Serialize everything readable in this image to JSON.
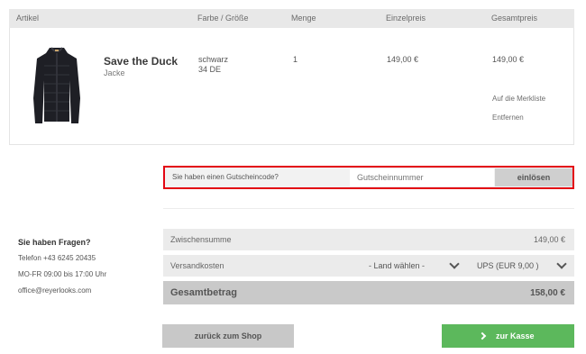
{
  "cart": {
    "headers": {
      "article": "Artikel",
      "color_size": "Farbe / Größe",
      "quantity": "Menge",
      "unit_price": "Einzelpreis",
      "total_price": "Gesamtpreis"
    },
    "item": {
      "image_icon": "jacket-image",
      "name": "Save the Duck",
      "type": "Jacke",
      "color": "schwarz",
      "size": "34 DE",
      "quantity": "1",
      "unit_price": "149,00 €",
      "total_price": "149,00 €",
      "wishlist_link": "Auf die Merkliste",
      "remove_link": "Entfernen"
    }
  },
  "coupon": {
    "label": "Sie haben einen Gutscheincode?",
    "placeholder": "Gutscheinnummer",
    "button": "einlösen",
    "highlight_color": "#e30613"
  },
  "totals": {
    "subtotal_label": "Zwischensumme",
    "subtotal_value": "149,00 €",
    "shipping_label": "Versandkosten",
    "country_select": "- Land wählen -",
    "carrier_select": "UPS (EUR 9,00 )",
    "grand_label": "Gesamtbetrag",
    "grand_value": "158,00 €"
  },
  "help": {
    "title": "Sie haben Fragen?",
    "phone": "Telefon +43 6245 20435",
    "hours": "MO-FR 09:00 bis 17:00 Uhr",
    "email": "office@reyerlooks.com"
  },
  "actions": {
    "back": "zurück zum Shop",
    "checkout": "zur Kasse",
    "checkout_color": "#5cb85c"
  }
}
